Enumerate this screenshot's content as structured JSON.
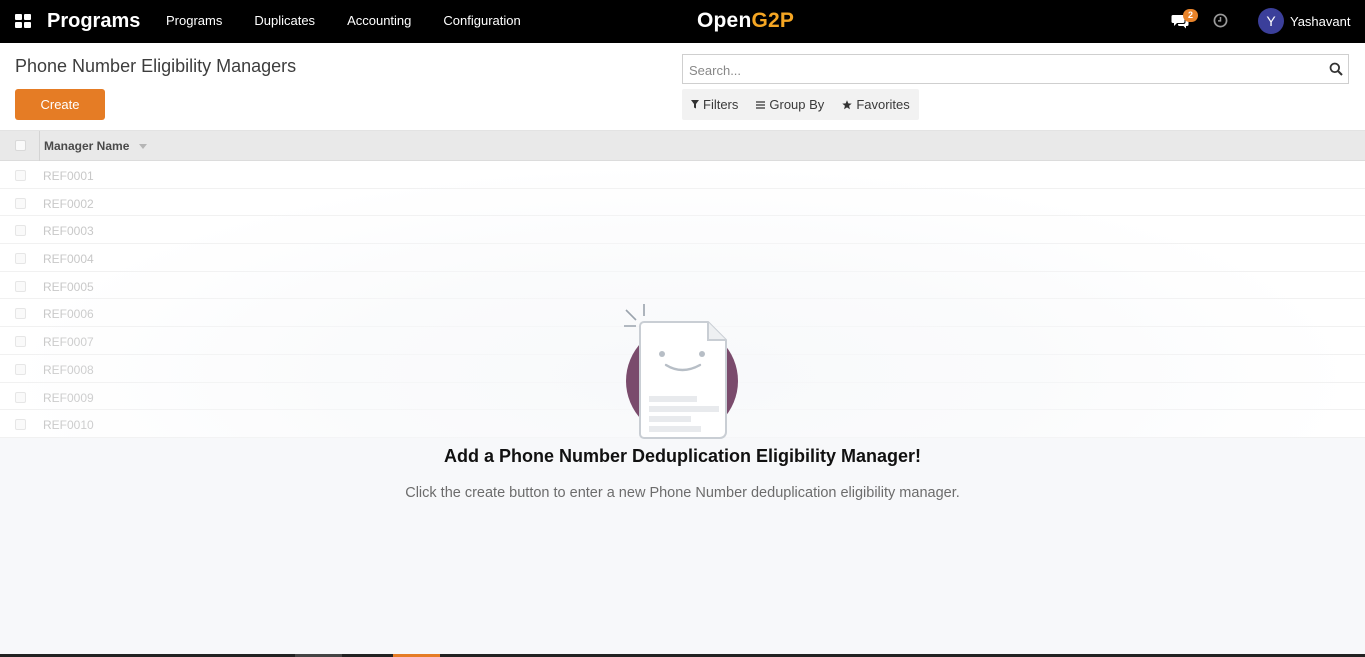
{
  "navbar": {
    "app_name": "Programs",
    "menu": [
      "Programs",
      "Duplicates",
      "Accounting",
      "Configuration"
    ],
    "brand_part1": "Open",
    "brand_part2": "G2P",
    "messages_count": "2",
    "user_initial": "Y",
    "user_name": "Yashavant"
  },
  "control_panel": {
    "title": "Phone Number Eligibility Managers",
    "create_label": "Create",
    "search_placeholder": "Search...",
    "filters_label": "Filters",
    "group_by_label": "Group By",
    "favorites_label": "Favorites"
  },
  "list": {
    "column_header": "Manager Name",
    "rows": [
      "REF0001",
      "REF0002",
      "REF0003",
      "REF0004",
      "REF0005",
      "REF0006",
      "REF0007",
      "REF0008",
      "REF0009",
      "REF0010"
    ]
  },
  "empty_helper": {
    "title": "Add a Phone Number Deduplication Eligibility Manager!",
    "text": "Click the create button to enter a new Phone Number deduplication eligibility manager."
  },
  "colors": {
    "navbar_bg": "#000000",
    "brand_accent": "#f5a623",
    "primary_button": "#e57c25",
    "avatar": "#3b3f9a",
    "illustration_circle": "#7a4b6c"
  },
  "icons": [
    "apps-grid-icon",
    "chat-icon",
    "clock-icon",
    "search-icon",
    "filter-icon",
    "group-by-icon",
    "star-icon",
    "sort-caret-icon"
  ]
}
